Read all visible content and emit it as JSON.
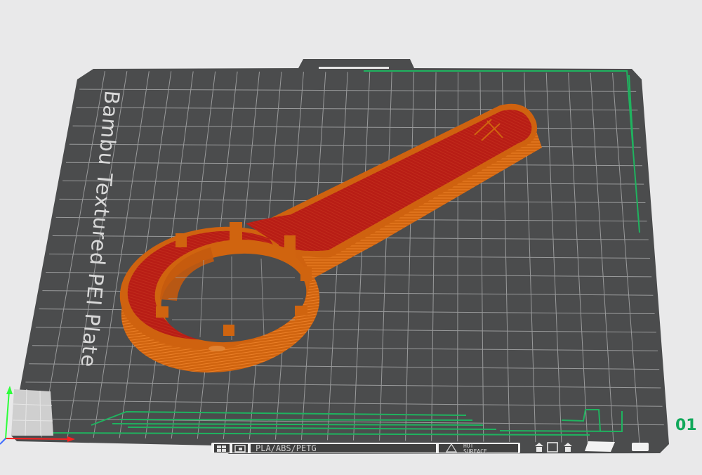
{
  "plate": {
    "label": "Bambu Textured PEI Plate",
    "number": "01",
    "filament_label": "PLA/ABS/PETG",
    "hot_surface_line1": "HOT",
    "hot_surface_line2": "SURFACE"
  },
  "icons": {
    "plate_icons": [
      "cooling-icon",
      "print-icon"
    ],
    "hot_warning": "warning-triangle-icon",
    "footer_icons": [
      "up-arrow-icon",
      "square-icon",
      "up-arrow-icon"
    ]
  },
  "colors": {
    "background": "#e9e9ea",
    "plate": "#4b4c4d",
    "grid": "#a7a8a9",
    "model_wall": "#d0640f",
    "model_top": "#b31f14",
    "green_marks": "#1fb35f",
    "axis_x": "#ff1f1f",
    "axis_y": "#2dff3a"
  }
}
